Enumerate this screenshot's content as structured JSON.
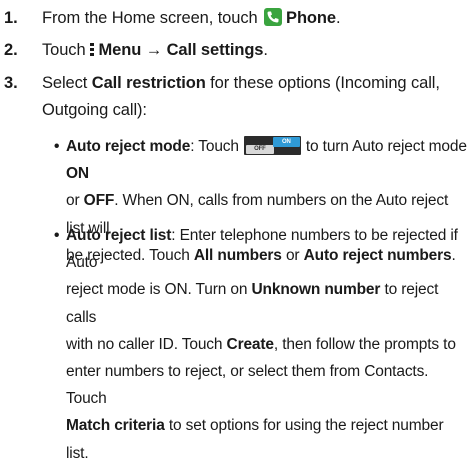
{
  "steps": [
    {
      "num": "1.",
      "t1": "From the Home screen, touch",
      "icon": "phone-icon",
      "b1": "Phone",
      "t2": "."
    },
    {
      "num": "2.",
      "t1": "Touch",
      "icon": "menu-icon",
      "b1": "Menu → Call settings",
      "t2": "."
    },
    {
      "num": "3.",
      "t1": "Select",
      "b1": "Call restriction",
      "t2": "for these options (Incoming call,",
      "t3": "Outgoing call):"
    }
  ],
  "bullets": [
    {
      "mark": "•",
      "label": "Auto reject mode",
      "l1a": ": Touch",
      "icon": "toggle-switch-icon",
      "toggle_on": "ON",
      "toggle_off": "OFF",
      "l1b": "to turn Auto reject mode",
      "l1c": "ON",
      "l2a": "or",
      "l2b": "OFF",
      "l2c": ". When ON, calls from numbers on the Auto reject list will",
      "l3a": "be rejected. Touch",
      "l3b": "All numbers",
      "l3c": "or",
      "l3d": "Auto reject numbers",
      "l3e": "."
    },
    {
      "mark": "•",
      "label": "Auto reject list",
      "l1a": ": Enter telephone numbers to be rejected if Auto",
      "l2": "reject mode is ON. Turn on",
      "l2b": "Unknown number",
      "l2c": "to reject calls",
      "l3a": "with no caller ID. Touch",
      "l3b": "Create",
      "l3c": ", then follow the prompts to",
      "l4": "enter numbers to reject, or select them from Contacts. Touch",
      "l5a": "Match criteria",
      "l5b": "to set options for using the reject number list."
    }
  ]
}
